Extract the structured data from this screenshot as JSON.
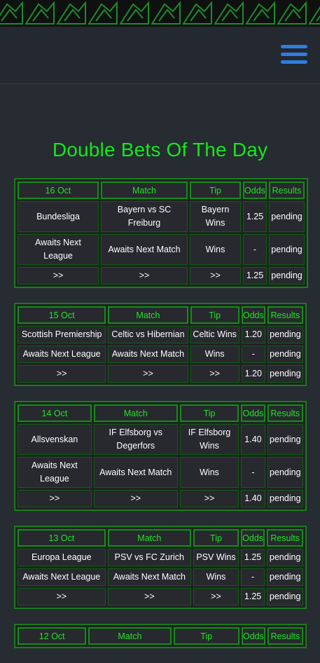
{
  "header": {
    "menu_icon": "hamburger-menu-icon",
    "accent": "#2f7de1"
  },
  "page_title": "Double Bets Of The Day",
  "colors": {
    "title": "#14e81a",
    "border": "#1c7a1d",
    "cell_bg": "#27292e",
    "page_bg": "#272b32"
  },
  "columns_label": {
    "match": "Match",
    "tip": "Tip",
    "odds": "Odds",
    "results": "Results"
  },
  "days": [
    {
      "date": "16 Oct",
      "rows": [
        {
          "league": "Bundesliga",
          "match": "Bayern vs SC Freiburg",
          "tip": "Bayern Wins",
          "odds": "1.25",
          "result": "pending"
        },
        {
          "league": "Awaits Next League",
          "match": "Awaits Next Match",
          "tip": "Wins",
          "odds": "-",
          "result": "pending"
        },
        {
          "league": ">>",
          "match": ">>",
          "tip": ">>",
          "odds": "1.25",
          "result": "pending"
        }
      ]
    },
    {
      "date": "15 Oct",
      "rows": [
        {
          "league": "Scottish Premiership",
          "match": "Celtic vs Hibernian",
          "tip": "Celtic Wins",
          "odds": "1.20",
          "result": "pending"
        },
        {
          "league": "Awaits Next League",
          "match": "Awaits Next Match",
          "tip": "Wins",
          "odds": "-",
          "result": "pending"
        },
        {
          "league": ">>",
          "match": ">>",
          "tip": ">>",
          "odds": "1.20",
          "result": "pending"
        }
      ]
    },
    {
      "date": "14 Oct",
      "rows": [
        {
          "league": "Allsvenskan",
          "match": "IF Elfsborg vs Degerfors",
          "tip": "IF Elfsborg Wins",
          "odds": "1.40",
          "result": "pending"
        },
        {
          "league": "Awaits Next League",
          "match": "Awaits Next Match",
          "tip": "Wins",
          "odds": "-",
          "result": "pending"
        },
        {
          "league": ">>",
          "match": ">>",
          "tip": ">>",
          "odds": "1.40",
          "result": "pending"
        }
      ]
    },
    {
      "date": "13 Oct",
      "rows": [
        {
          "league": "Europa League",
          "match": "PSV vs FC Zurich",
          "tip": "PSV Wins",
          "odds": "1.25",
          "result": "pending"
        },
        {
          "league": "Awaits Next League",
          "match": "Awaits Next Match",
          "tip": "Wins",
          "odds": "-",
          "result": "pending"
        },
        {
          "league": ">>",
          "match": ">>",
          "tip": ">>",
          "odds": "1.25",
          "result": "pending"
        }
      ]
    },
    {
      "date": "12 Oct",
      "rows": []
    }
  ]
}
